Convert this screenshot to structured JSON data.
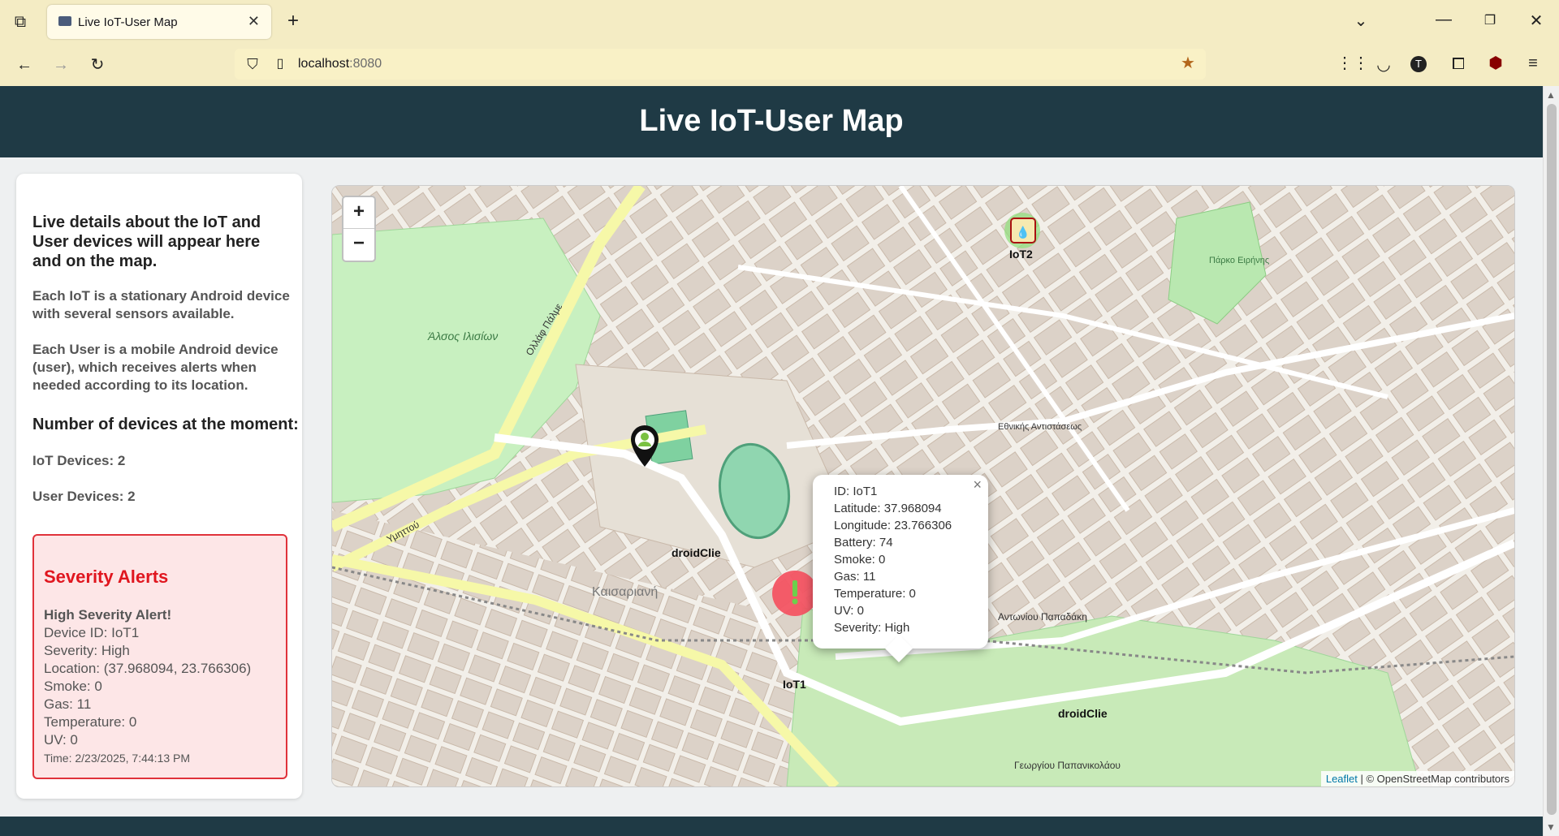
{
  "browser": {
    "tab_title": "Live IoT-User Map",
    "url_host": "localhost",
    "url_port": ":8080"
  },
  "page": {
    "title": "Live IoT-User Map"
  },
  "sidebar": {
    "intro": "Live details about the IoT and User devices will appear here and on the map.",
    "iot_desc": "Each IoT is a stationary Android device with several sensors available.",
    "user_desc": "Each User is a mobile Android device (user), which receives alerts when needed according to its location.",
    "count_heading": "Number of devices at the moment:",
    "iot_count": "IoT Devices: 2",
    "user_count": "User Devices: 2"
  },
  "alerts": {
    "title": "Severity Alerts",
    "heading": "High Severity Alert!",
    "device": "Device ID: IoT1",
    "severity": "Severity: High",
    "location": "Location: (37.968094, 23.766306)",
    "smoke": "Smoke: 0",
    "gas": "Gas: 11",
    "temperature": "Temperature: 0",
    "uv": "UV: 0",
    "time": "Time: 2/23/2025, 7:44:13 PM"
  },
  "map": {
    "zoom_in": "+",
    "zoom_out": "−",
    "popup": {
      "id": "ID: IoT1",
      "lat": "Latitude: 37.968094",
      "lng": "Longitude: 23.766306",
      "battery": "Battery: 74",
      "smoke": "Smoke: 0",
      "gas": "Gas: 11",
      "temperature": "Temperature: 0",
      "uv": "UV: 0",
      "severity": "Severity: High",
      "close": "×"
    },
    "markers": {
      "iot1": "IoT1",
      "iot2": "IoT2",
      "user1": "droidClie",
      "user2": "droidClie"
    },
    "street_labels": [
      "Καισαριανή",
      "Άλσος Ιλισίων",
      "Αντωνίου Παπαδάκη",
      "Εθνικής Αντιστάσεως",
      "Γεωργίου Παπανικολάου",
      "Πάρκο Ειρήνης",
      "Ολλάφ Πάλμε",
      "Υμηττού"
    ],
    "attribution_leaflet": "Leaflet",
    "attribution_rest": " | © OpenStreetMap contributors"
  },
  "colors": {
    "header": "#1f3a45",
    "alert_red": "#e0161f",
    "park_green": "#c8f0c0",
    "road_yellow": "#f6f8a8",
    "iot_alert_marker": "#f35463"
  }
}
